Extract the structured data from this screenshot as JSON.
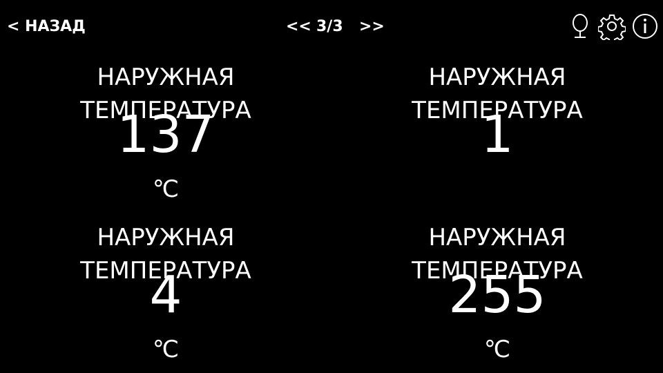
{
  "header": {
    "back_label": "< НАЗАД",
    "prev_label": "<<",
    "page_indicator": "3/3",
    "next_label": ">>"
  },
  "icons": [
    "mirror-icon",
    "gear-icon",
    "info-icon"
  ],
  "tiles": [
    {
      "label_line1": "НАРУЖНАЯ",
      "label_line2": "ТЕМПЕРАТУРА",
      "value": "137",
      "unit": "℃"
    },
    {
      "label_line1": "НАРУЖНАЯ",
      "label_line2": "ТЕМПЕРАТУРА",
      "value": "1",
      "unit": ""
    },
    {
      "label_line1": "НАРУЖНАЯ",
      "label_line2": "ТЕМПЕРАТУРА",
      "value": "4",
      "unit": "℃"
    },
    {
      "label_line1": "НАРУЖНАЯ",
      "label_line2": "ТЕМПЕРАТУРА",
      "value": "255",
      "unit": "℃"
    }
  ]
}
